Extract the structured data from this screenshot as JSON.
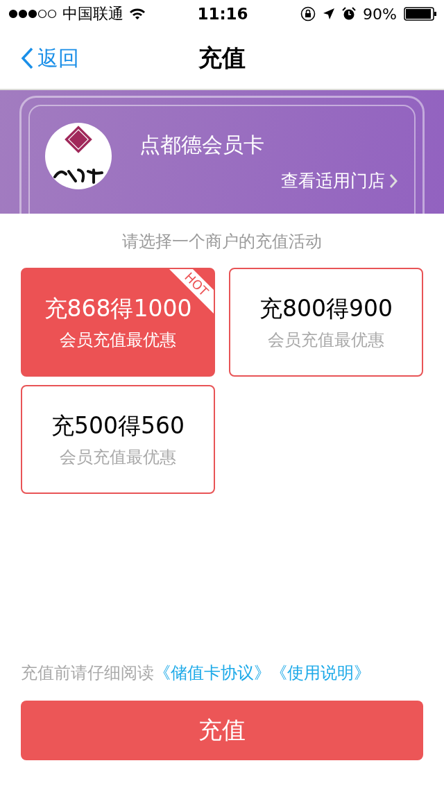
{
  "status_bar": {
    "carrier": "中国联通",
    "time": "11:16",
    "battery": "90%"
  },
  "nav": {
    "back": "返回",
    "title": "充值"
  },
  "card": {
    "name": "点都德会员卡",
    "link": "查看适用门店"
  },
  "prompt": "请选择一个商户的充值活动",
  "options": [
    {
      "title": "充868得1000",
      "subtitle": "会员充值最优惠",
      "selected": true,
      "badge": "HOT"
    },
    {
      "title": "充800得900",
      "subtitle": "会员充值最优惠",
      "selected": false
    },
    {
      "title": "充500得560",
      "subtitle": "会员充值最优惠",
      "selected": false
    }
  ],
  "agreement": {
    "text": "充值前请仔细阅读",
    "links": [
      "《储值卡协议》",
      "《使用说明》"
    ]
  },
  "submit": "充值"
}
